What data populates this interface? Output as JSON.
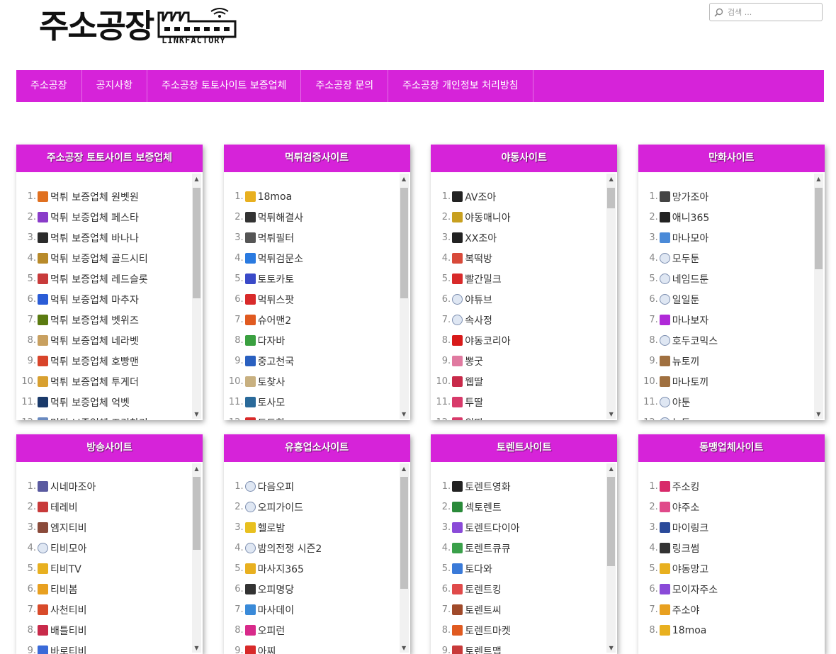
{
  "header": {
    "logo_text": "주소공장",
    "logo_sub": "LINKFACTORY",
    "search_placeholder": "검색 ..."
  },
  "nav": [
    {
      "label": "주소공장"
    },
    {
      "label": "공지사항"
    },
    {
      "label": "주소공장 토토사이트 보증업체"
    },
    {
      "label": "주소공장 문의"
    },
    {
      "label": "주소공장 개인정보 처리방침"
    }
  ],
  "colors": {
    "accent": "#d623d9",
    "scroll_thumb": "#c1c1c1"
  },
  "widgets": [
    {
      "title": "주소공장 토토사이트 보증업체",
      "items": [
        {
          "n": "1.",
          "label": "먹튀 보증업체 원벳원",
          "icon": "one-bet-icon",
          "color": "#e07020"
        },
        {
          "n": "2.",
          "label": "먹튀 보증업체 페스타",
          "icon": "festa-icon",
          "color": "#8a3cc9"
        },
        {
          "n": "3.",
          "label": "먹튀 보증업체 바나나",
          "icon": "banana-icon",
          "color": "#2b2b2b"
        },
        {
          "n": "4.",
          "label": "먹튀 보증업체 골드시티",
          "icon": "gold-city-icon",
          "color": "#b88a2a"
        },
        {
          "n": "5.",
          "label": "먹튀 보증업체 레드슬롯",
          "icon": "red-slot-icon",
          "color": "#c83a3a"
        },
        {
          "n": "6.",
          "label": "먹튀 보증업체 마추자",
          "icon": "m-logo-icon",
          "color": "#2a5cd6"
        },
        {
          "n": "7.",
          "label": "먹튀 보증업체 벳위즈",
          "icon": "betwiz-icon",
          "color": "#5a7a10"
        },
        {
          "n": "8.",
          "label": "먹튀 보증업체 네라벳",
          "icon": "nerabet-icon",
          "color": "#c8a060"
        },
        {
          "n": "9.",
          "label": "먹튀 보증업체 호빵맨",
          "icon": "hobbangman-icon",
          "color": "#d8442a"
        },
        {
          "n": "10.",
          "label": "먹튀 보증업체 투게더",
          "icon": "together-icon",
          "color": "#d8a030"
        },
        {
          "n": "11.",
          "label": "먹튀 보증업체 억벳",
          "icon": "eokbet-icon",
          "color": "#1a3a6a"
        },
        {
          "n": "12.",
          "label": "먹튀 보증업체 즈건찬기",
          "icon": "partial-icon",
          "color": "#6a8ac0"
        }
      ],
      "scroll": {
        "thumb_top": 0.02,
        "thumb_size": 0.49
      }
    },
    {
      "title": "먹튀검증사이트",
      "items": [
        {
          "n": "1.",
          "label": "18moa",
          "icon": "18-icon",
          "color": "#e8b020"
        },
        {
          "n": "2.",
          "label": "먹튀해결사",
          "icon": "solver-icon",
          "color": "#333333"
        },
        {
          "n": "3.",
          "label": "먹튀필터",
          "icon": "filter-icon",
          "color": "#555555"
        },
        {
          "n": "4.",
          "label": "먹튀검문소",
          "icon": "checkpoint-icon",
          "color": "#2a7ae0"
        },
        {
          "n": "5.",
          "label": "토토카토",
          "icon": "totocato-icon",
          "color": "#3a4ac8"
        },
        {
          "n": "6.",
          "label": "먹튀스팟",
          "icon": "pin-icon",
          "color": "#d82a2a"
        },
        {
          "n": "7.",
          "label": "슈어맨2",
          "icon": "sureman-icon",
          "color": "#e05a20"
        },
        {
          "n": "8.",
          "label": "다자바",
          "icon": "dajaba-icon",
          "color": "#3aa040"
        },
        {
          "n": "9.",
          "label": "중고천국",
          "icon": "ring-icon",
          "color": "#2a60c0"
        },
        {
          "n": "10.",
          "label": "토찾사",
          "icon": "tochasa-icon",
          "color": "#c8b080"
        },
        {
          "n": "11.",
          "label": "토사모",
          "icon": "tosamo-icon",
          "color": "#2a6a9a"
        },
        {
          "n": "12.",
          "label": "토토핫",
          "icon": "totohot-icon",
          "color": "#d82a2a"
        }
      ],
      "scroll": {
        "thumb_top": 0.02,
        "thumb_size": 0.49
      }
    },
    {
      "title": "야동사이트",
      "items": [
        {
          "n": "1.",
          "label": "AV조아",
          "icon": "xx-icon",
          "color": "#222222"
        },
        {
          "n": "2.",
          "label": "야동매니아",
          "icon": "play-icon",
          "color": "#c8a020"
        },
        {
          "n": "3.",
          "label": "XX조아",
          "icon": "xx-icon",
          "color": "#222222"
        },
        {
          "n": "4.",
          "label": "복떡방",
          "icon": "bokddeok-icon",
          "color": "#d84a3a"
        },
        {
          "n": "5.",
          "label": "빨간밀크",
          "icon": "milk-icon",
          "color": "#d82a2a"
        },
        {
          "n": "6.",
          "label": "야튜브",
          "icon": "globe-icon",
          "color": "#7d8fb0"
        },
        {
          "n": "7.",
          "label": "속사정",
          "icon": "globe-icon",
          "color": "#7d8fb0"
        },
        {
          "n": "8.",
          "label": "야동코리아",
          "icon": "y-logo-icon",
          "color": "#d81a1a"
        },
        {
          "n": "9.",
          "label": "뽕굿",
          "icon": "ppong-icon",
          "color": "#e07aa0"
        },
        {
          "n": "10.",
          "label": "웹딸",
          "icon": "webddal-icon",
          "color": "#c82a4a"
        },
        {
          "n": "11.",
          "label": "투딸",
          "icon": "tuddal-icon",
          "color": "#d83a6a"
        },
        {
          "n": "12.",
          "label": "위딸",
          "icon": "widdal-icon",
          "color": "#d83a6a"
        }
      ],
      "scroll": {
        "thumb_top": 0.02,
        "thumb_size": 0.09
      }
    },
    {
      "title": "만화사이트",
      "items": [
        {
          "n": "1.",
          "label": "망가조아",
          "icon": "mangajoa-icon",
          "color": "#444444"
        },
        {
          "n": "2.",
          "label": "애니365",
          "icon": "ani-icon",
          "color": "#222222"
        },
        {
          "n": "3.",
          "label": "마나모아",
          "icon": "manamoa-icon",
          "color": "#4a8ad8"
        },
        {
          "n": "4.",
          "label": "모두툰",
          "icon": "globe-icon",
          "color": "#7d8fb0"
        },
        {
          "n": "5.",
          "label": "네임드툰",
          "icon": "globe-icon",
          "color": "#7d8fb0"
        },
        {
          "n": "6.",
          "label": "일일툰",
          "icon": "globe-icon",
          "color": "#7d8fb0"
        },
        {
          "n": "7.",
          "label": "마나보자",
          "icon": "m-small-icon",
          "color": "#b02ad8"
        },
        {
          "n": "8.",
          "label": "호두코믹스",
          "icon": "globe-icon",
          "color": "#7d8fb0"
        },
        {
          "n": "9.",
          "label": "뉴토끼",
          "icon": "rabbit-icon",
          "color": "#a07040"
        },
        {
          "n": "10.",
          "label": "마나토끼",
          "icon": "rabbit-icon",
          "color": "#a07040"
        },
        {
          "n": "11.",
          "label": "야툰",
          "icon": "globe-icon",
          "color": "#7d8fb0"
        },
        {
          "n": "12.",
          "label": "늑툰",
          "icon": "globe-icon",
          "color": "#7d8fb0"
        }
      ],
      "scroll": {
        "thumb_top": 0.02,
        "thumb_size": 0.36
      }
    },
    {
      "title": "방송사이트",
      "items": [
        {
          "n": "1.",
          "label": "시네마조아",
          "icon": "cinema-icon",
          "color": "#5a5aa0"
        },
        {
          "n": "2.",
          "label": "테레비",
          "icon": "terebi-icon",
          "color": "#c83a3a"
        },
        {
          "n": "3.",
          "label": "엠지티비",
          "icon": "mgtv-icon",
          "color": "#8a4a3a"
        },
        {
          "n": "4.",
          "label": "티비모아",
          "icon": "globe-icon",
          "color": "#7d8fb0"
        },
        {
          "n": "5.",
          "label": "티비TV",
          "icon": "tvtv-icon",
          "color": "#e8b020"
        },
        {
          "n": "6.",
          "label": "티비봄",
          "icon": "tvbom-icon",
          "color": "#e8a020"
        },
        {
          "n": "7.",
          "label": "사천티비",
          "icon": "sacheon-icon",
          "color": "#d84a2a"
        },
        {
          "n": "8.",
          "label": "배틀티비",
          "icon": "battle-icon",
          "color": "#c82a4a"
        },
        {
          "n": "9.",
          "label": "바로티비",
          "icon": "baro-icon",
          "color": "#3a6ad8"
        }
      ],
      "scroll": {
        "thumb_top": 0.02,
        "thumb_size": 0.43
      }
    },
    {
      "title": "유흥업소사이트",
      "items": [
        {
          "n": "1.",
          "label": "다음오피",
          "icon": "globe-icon",
          "color": "#7d8fb0"
        },
        {
          "n": "2.",
          "label": "오피가이드",
          "icon": "globe-icon",
          "color": "#7d8fb0"
        },
        {
          "n": "3.",
          "label": "헬로밤",
          "icon": "moon-icon",
          "color": "#e8c020"
        },
        {
          "n": "4.",
          "label": "밤의전쟁 시즌2",
          "icon": "globe-icon",
          "color": "#7d8fb0"
        },
        {
          "n": "5.",
          "label": "마사지365",
          "icon": "m-yellow-icon",
          "color": "#e8b020"
        },
        {
          "n": "6.",
          "label": "오피명당",
          "icon": "opi-icon",
          "color": "#333333"
        },
        {
          "n": "7.",
          "label": "마사데이",
          "icon": "m-blue-icon",
          "color": "#3a8ad8"
        },
        {
          "n": "8.",
          "label": "오피런",
          "icon": "heart-icon",
          "color": "#d82a8a"
        },
        {
          "n": "9.",
          "label": "아찌",
          "icon": "red-dot-icon",
          "color": "#d82a2a"
        }
      ],
      "scroll": {
        "thumb_top": 0.02,
        "thumb_size": 0.66
      }
    },
    {
      "title": "토렌트사이트",
      "items": [
        {
          "n": "1.",
          "label": "토렌트영화",
          "icon": "m-black-icon",
          "color": "#222222"
        },
        {
          "n": "2.",
          "label": "섹토렌트",
          "icon": "s-green-icon",
          "color": "#2a8a3a"
        },
        {
          "n": "3.",
          "label": "토렌트다이아",
          "icon": "diamond-icon",
          "color": "#8a4ad8"
        },
        {
          "n": "4.",
          "label": "토렌트큐큐",
          "icon": "qq-icon",
          "color": "#3aa04a"
        },
        {
          "n": "5.",
          "label": "토다와",
          "icon": "folder-icon",
          "color": "#3a7ad8"
        },
        {
          "n": "6.",
          "label": "토렌트킹",
          "icon": "k-red-icon",
          "color": "#e04a4a"
        },
        {
          "n": "7.",
          "label": "토렌트씨",
          "icon": "t-brown-icon",
          "color": "#a04a2a"
        },
        {
          "n": "8.",
          "label": "토렌트마켓",
          "icon": "torrent-market-icon",
          "color": "#e05a20"
        },
        {
          "n": "9.",
          "label": "토렌트맵",
          "icon": "map-icon",
          "color": "#c83a3a"
        }
      ],
      "scroll": {
        "thumb_top": 0.02,
        "thumb_size": 0.53
      }
    },
    {
      "title": "동맹업체사이트",
      "items": [
        {
          "n": "1.",
          "label": "주소킹",
          "icon": "king-icon",
          "color": "#d82a6a"
        },
        {
          "n": "2.",
          "label": "야주소",
          "icon": "ya-icon",
          "color": "#e04a8a"
        },
        {
          "n": "3.",
          "label": "마이링크",
          "icon": "link-icon",
          "color": "#2a4a9a"
        },
        {
          "n": "4.",
          "label": "링크썸",
          "icon": "external-icon",
          "color": "#333333"
        },
        {
          "n": "5.",
          "label": "야동망고",
          "icon": "mango-icon",
          "color": "#e8b020"
        },
        {
          "n": "6.",
          "label": "모이자주소",
          "icon": "moija-icon",
          "color": "#8a4ad8"
        },
        {
          "n": "7.",
          "label": "주소야",
          "icon": "juso-ya-icon",
          "color": "#e8a020"
        },
        {
          "n": "8.",
          "label": "18moa",
          "icon": "18-icon",
          "color": "#e8b020"
        }
      ],
      "scroll": null
    }
  ]
}
